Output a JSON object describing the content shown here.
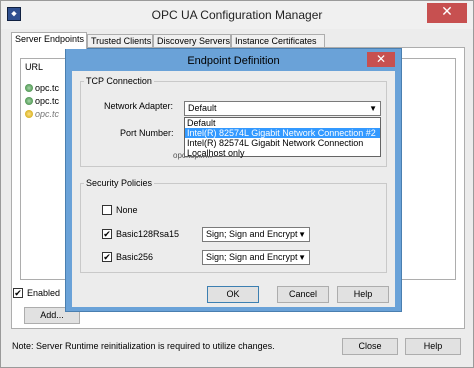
{
  "window": {
    "title": "OPC UA Configuration Manager",
    "close_glyph": "✕",
    "app_icon": "ua-logo-icon"
  },
  "tabs": [
    {
      "label": "Server Endpoints"
    },
    {
      "label": "Trusted Clients"
    },
    {
      "label": "Discovery Servers"
    },
    {
      "label": "Instance Certificates"
    }
  ],
  "endpoints": {
    "column_header": "URL",
    "rows": [
      {
        "text": "opc.tc",
        "enabled": true
      },
      {
        "text": "opc.tc",
        "enabled": true
      },
      {
        "text": "opc.tc",
        "enabled": false
      }
    ],
    "enabled_label": "Enabled",
    "enabled_checked": "✔",
    "add_label": "Add..."
  },
  "footer": {
    "note": "Note:  Server Runtime reinitialization is required to utilize changes.",
    "close_label": "Close",
    "help_label": "Help"
  },
  "dialog": {
    "title": "Endpoint Definition",
    "close_glyph": "✕",
    "tcp_group": "TCP Connection",
    "network_adapter_label": "Network Adapter:",
    "network_adapter_value": "Default",
    "adapter_options": [
      "Default",
      "Intel(R) 82574L Gigabit Network Connection #2",
      "Intel(R) 82574L Gigabit Network Connection",
      "Localhost only"
    ],
    "highlighted_option_index": 1,
    "port_label": "Port Number:",
    "obscured_text": "opc.tcp://...",
    "security_group": "Security Policies",
    "policies": [
      {
        "label": "None",
        "checked": "",
        "mode": ""
      },
      {
        "label": "Basic128Rsa15",
        "checked": "✔",
        "mode": "Sign; Sign and Encrypt"
      },
      {
        "label": "Basic256",
        "checked": "✔",
        "mode": "Sign; Sign and Encrypt"
      }
    ],
    "ok_label": "OK",
    "cancel_label": "Cancel",
    "help_label": "Help"
  },
  "colors": {
    "dialog_frame": "#6aa2d8",
    "selection": "#3399ff",
    "close_red": "#c75050"
  }
}
